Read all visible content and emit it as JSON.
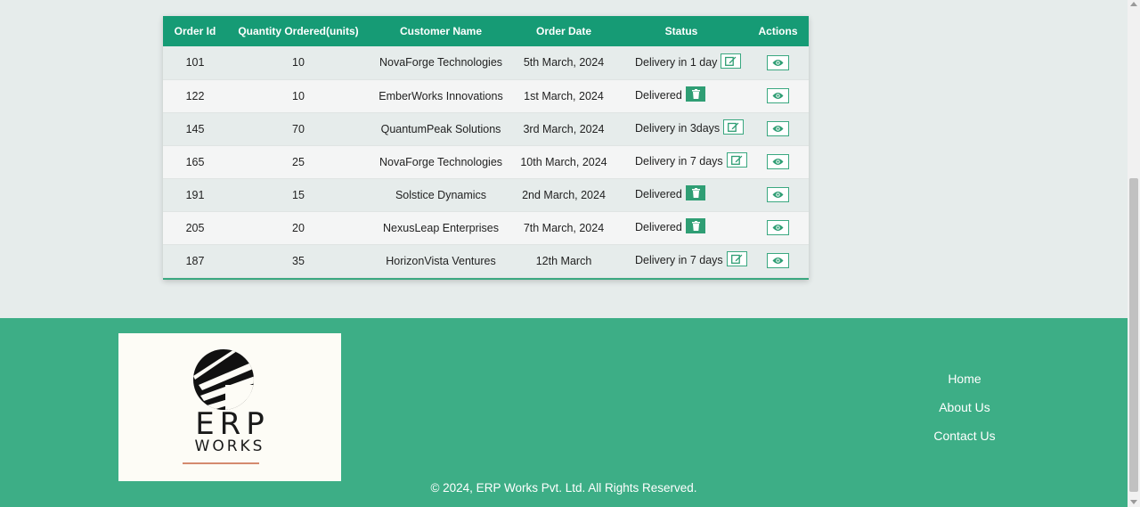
{
  "table": {
    "headers": [
      "Order Id",
      "Quantity Ordered(units)",
      "Customer Name",
      "Order Date",
      "Status",
      "Actions"
    ],
    "rows": [
      {
        "id": "101",
        "qty": "10",
        "customer": "NovaForge Technologies",
        "date": "5th March, 2024",
        "status": "Delivery in 1 day",
        "status_action": "edit"
      },
      {
        "id": "122",
        "qty": "10",
        "customer": "EmberWorks Innovations",
        "date": "1st March, 2024",
        "status": "Delivered",
        "status_action": "delete"
      },
      {
        "id": "145",
        "qty": "70",
        "customer": "QuantumPeak Solutions",
        "date": "3rd March, 2024",
        "status": "Delivery in 3days",
        "status_action": "edit"
      },
      {
        "id": "165",
        "qty": "25",
        "customer": "NovaForge Technologies",
        "date": "10th March, 2024",
        "status": "Delivery in 7 days",
        "status_action": "edit"
      },
      {
        "id": "191",
        "qty": "15",
        "customer": "Solstice Dynamics",
        "date": "2nd March, 2024",
        "status": "Delivered",
        "status_action": "delete"
      },
      {
        "id": "205",
        "qty": "20",
        "customer": "NexusLeap Enterprises",
        "date": "7th March, 2024",
        "status": "Delivered",
        "status_action": "delete"
      },
      {
        "id": "187",
        "qty": "35",
        "customer": "HorizonVista Ventures",
        "date": "12th March",
        "status": "Delivery in 7 days",
        "status_action": "edit"
      }
    ],
    "action_icon": "eye-icon"
  },
  "footer": {
    "logo": {
      "line1": "ERP",
      "line2": "WORKS"
    },
    "links": [
      "Home",
      "About Us",
      "Contact Us"
    ],
    "copyright": "© 2024, ERP Works Pvt. Ltd. All Rights Reserved."
  },
  "colors": {
    "accent": "#169b75",
    "footer_bg": "#3dae86",
    "page_bg": "#e6eceb"
  }
}
